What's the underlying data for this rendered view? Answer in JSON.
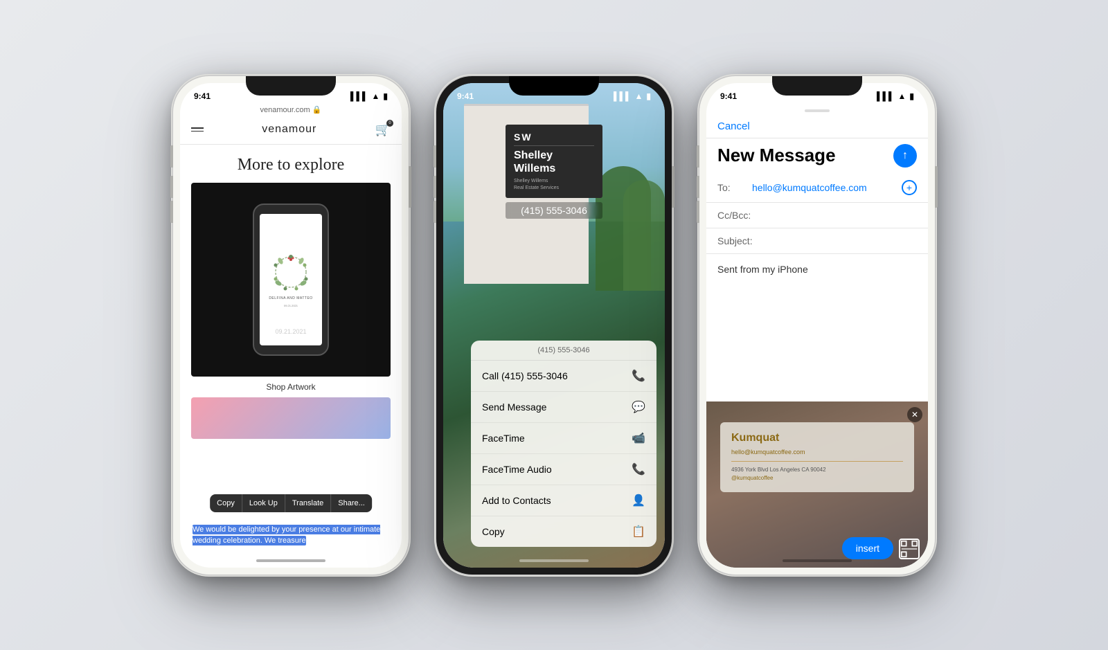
{
  "bg": {
    "color": "#dde0e6"
  },
  "phone1": {
    "status_time": "9:41",
    "address": "venamour.com",
    "logo": "venamour",
    "page_heading": "More to explore",
    "inner_wedding_name": "DELFINA AND MATTEO",
    "inner_date": "09.21.2021",
    "context_copy": "Copy",
    "context_lookup": "Look Up",
    "context_translate": "Translate",
    "context_share": "Share...",
    "selected_text": "We would be delighted by your presence at our intimate wedding celebration. We treasure",
    "shop_label": "Shop Artwork"
  },
  "phone2": {
    "status_time": "9:41",
    "sign_sw": "SW",
    "sign_name1": "Shelley",
    "sign_name2": "Willems",
    "sign_subtitle1": "Shelley Willems",
    "sign_subtitle2": "Real Estate Services",
    "phone_number": "(415) 555-3046",
    "action_header": "(415) 555-3046",
    "actions": [
      {
        "label": "Call (415) 555-3046",
        "icon": "📞"
      },
      {
        "label": "Send Message",
        "icon": "💬"
      },
      {
        "label": "FaceTime",
        "icon": "📹"
      },
      {
        "label": "FaceTime Audio",
        "icon": "🔊"
      },
      {
        "label": "Add to Contacts",
        "icon": "👤"
      },
      {
        "label": "Copy",
        "icon": "📋"
      }
    ]
  },
  "phone3": {
    "status_time": "9:41",
    "cancel_label": "Cancel",
    "title": "New Message",
    "to_label": "To:",
    "to_value": "hello@kumquatcoffee.com",
    "cc_label": "Cc/Bcc:",
    "subject_label": "Subject:",
    "body_text": "Sent from my iPhone",
    "biz_brand": "Kumquat",
    "biz_email": "hello@kumquatcoffee.com",
    "biz_address1": "4936 York Blvd Los Angeles CA 90042",
    "biz_handle": "@kumquatcoffee",
    "insert_label": "insert",
    "close_symbol": "✕"
  }
}
